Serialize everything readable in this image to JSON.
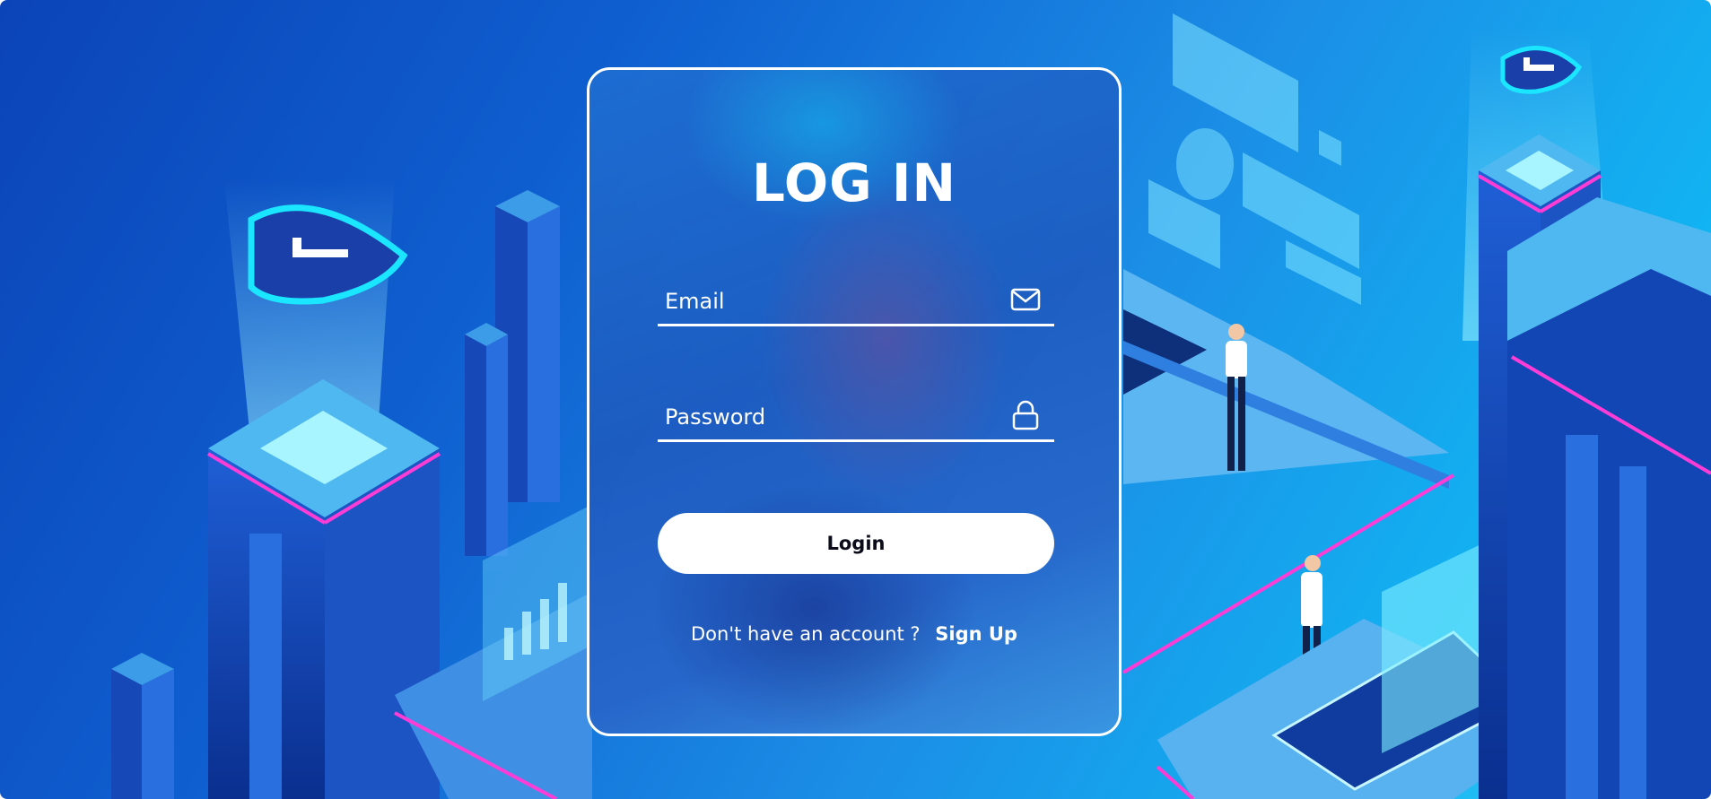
{
  "login": {
    "title": "LOG IN",
    "email_placeholder": "Email",
    "email_value": "",
    "password_placeholder": "Password",
    "password_value": "",
    "email_icon": "mail-icon",
    "password_icon": "lock-icon",
    "submit_label": "Login",
    "signup_prompt": "Don't have an account ?",
    "signup_link": "Sign Up"
  },
  "colors": {
    "background_start": "#0b44b8",
    "background_end": "#46d3fb",
    "card_border": "#ffffff",
    "button_background": "#ffffff",
    "button_text": "#0b0b1a",
    "accent_neon": "#ff3dd6"
  }
}
